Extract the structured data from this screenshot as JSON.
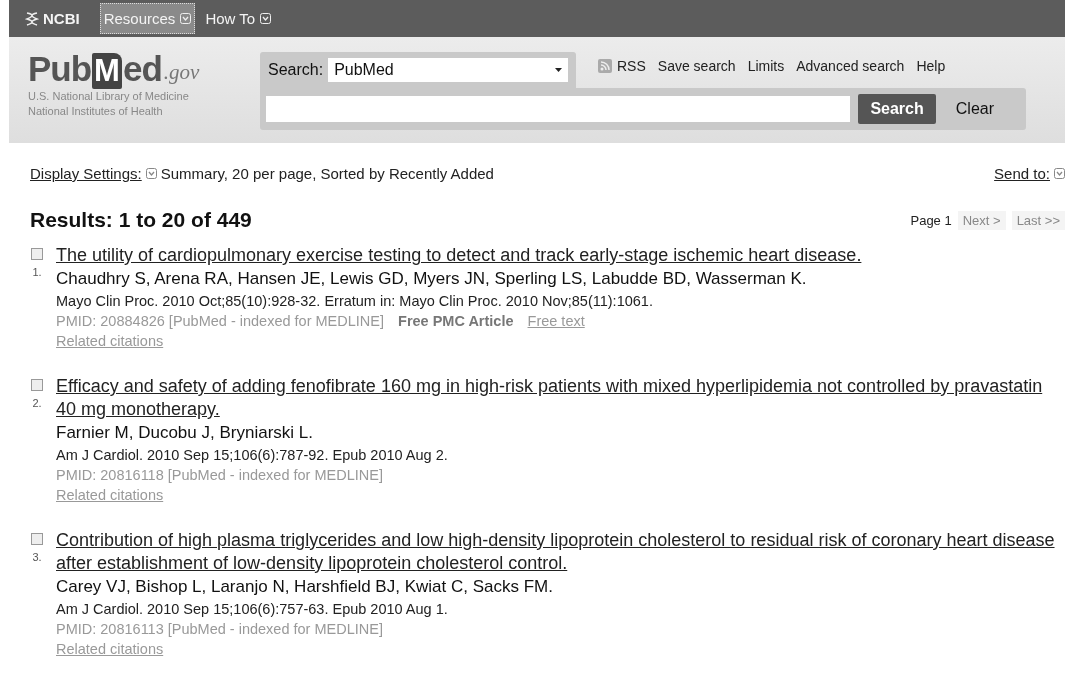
{
  "top_bar": {
    "items": [
      {
        "kind": "logo",
        "label": "NCBI"
      },
      {
        "kind": "menu",
        "label": "Resources",
        "selected": true
      },
      {
        "kind": "menu",
        "label": "How To",
        "selected": false
      }
    ]
  },
  "logo": {
    "name_parts": [
      "Pub",
      "M",
      "ed"
    ],
    "domain": ".gov",
    "lines": [
      "U.S. National Library of Medicine",
      "National Institutes of Health"
    ]
  },
  "search": {
    "label": "Search:",
    "database": "PubMed",
    "links": [
      {
        "kind": "rss",
        "label": "RSS"
      },
      {
        "kind": "link",
        "label": "Save search"
      },
      {
        "kind": "link",
        "label": "Limits"
      },
      {
        "kind": "link",
        "label": "Advanced search"
      },
      {
        "kind": "link",
        "label": "Help"
      }
    ],
    "buttons": [
      {
        "kind": "primary",
        "label": "Search"
      },
      {
        "kind": "plain",
        "label": "Clear"
      }
    ]
  },
  "display_settings": {
    "label": "Display Settings:",
    "value": "Summary, 20 per page, Sorted by Recently Added",
    "send_to": "Send to:"
  },
  "results": {
    "heading": "Results: 1 to 20 of 449",
    "pagination": {
      "page": "Page 1",
      "next": "Next >",
      "last": "Last >>"
    },
    "items": [
      {
        "number": "1.",
        "checked": false,
        "title": "The utility of cardiopulmonary exercise testing to detect and track early-stage ischemic heart disease.",
        "authors": "Chaudhry S, Arena RA, Hansen JE, Lewis GD, Myers JN, Sperling LS, Labudde BD, Wasserman K.",
        "citation": "Mayo Clin Proc. 2010 Oct;85(10):928-32. Erratum in: Mayo Clin Proc. 2010 Nov;85(11):1061.",
        "pmid": "PMID: 20884826 [PubMed - indexed for MEDLINE]",
        "free_pmc": "Free PMC Article",
        "free_text": "Free text",
        "related": "Related citations"
      },
      {
        "number": "2.",
        "checked": false,
        "title": "Efficacy and safety of adding fenofibrate 160 mg in high-risk patients with mixed hyperlipidemia not controlled by pravastatin 40 mg monotherapy.",
        "authors": "Farnier M, Ducobu J, Bryniarski L.",
        "citation": "Am J Cardiol. 2010 Sep 15;106(6):787-92. Epub 2010 Aug 2.",
        "pmid": "PMID: 20816118 [PubMed - indexed for MEDLINE]",
        "related": "Related citations"
      },
      {
        "number": "3.",
        "checked": false,
        "title": "Contribution of high plasma triglycerides and low high-density lipoprotein cholesterol to residual risk of coronary heart disease after establishment of low-density lipoprotein cholesterol control.",
        "authors": "Carey VJ, Bishop L, Laranjo N, Harshfield BJ, Kwiat C, Sacks FM.",
        "citation": "Am J Cardiol. 2010 Sep 15;106(6):757-63. Epub 2010 Aug 1.",
        "pmid": "PMID: 20816113 [PubMed - indexed for MEDLINE]",
        "related": "Related citations"
      }
    ]
  }
}
